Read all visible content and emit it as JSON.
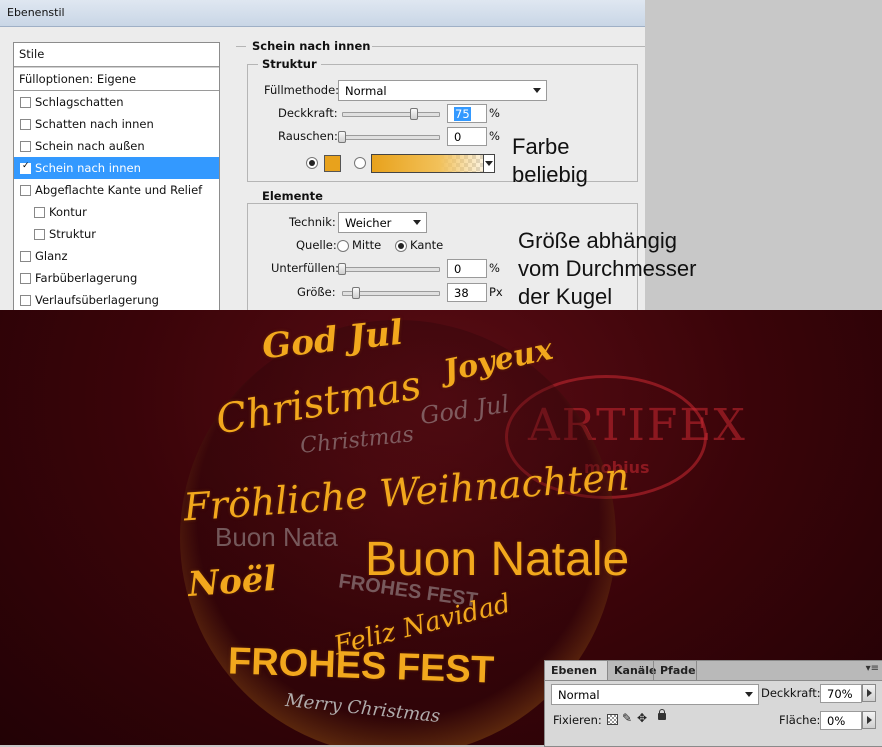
{
  "dialog": {
    "title": "Ebenenstil",
    "styles_header": "Stile",
    "blend_options": "Fülloptionen: Eigene",
    "styles": [
      {
        "label": "Schlagschatten",
        "checked": false,
        "indent": false,
        "selected": false
      },
      {
        "label": "Schatten nach innen",
        "checked": false,
        "indent": false,
        "selected": false
      },
      {
        "label": "Schein nach außen",
        "checked": false,
        "indent": false,
        "selected": false
      },
      {
        "label": "Schein nach innen",
        "checked": true,
        "indent": false,
        "selected": true
      },
      {
        "label": "Abgeflachte Kante und Relief",
        "checked": false,
        "indent": false,
        "selected": false
      },
      {
        "label": "Kontur",
        "checked": false,
        "indent": true,
        "selected": false
      },
      {
        "label": "Struktur",
        "checked": false,
        "indent": true,
        "selected": false
      },
      {
        "label": "Glanz",
        "checked": false,
        "indent": false,
        "selected": false
      },
      {
        "label": "Farbüberlagerung",
        "checked": false,
        "indent": false,
        "selected": false
      },
      {
        "label": "Verlaufsüberlagerung",
        "checked": false,
        "indent": false,
        "selected": false
      }
    ],
    "section_title": "Schein nach innen",
    "structure": {
      "title": "Struktur",
      "blend_mode_label": "Füllmethode:",
      "blend_mode_value": "Normal",
      "opacity_label": "Deckkraft:",
      "opacity_value": "75",
      "opacity_unit": "%",
      "opacity_slider": 0.75,
      "noise_label": "Rauschen:",
      "noise_value": "0",
      "noise_unit": "%",
      "noise_slider": 0.0,
      "color_swatch": "#e8a21c"
    },
    "elements": {
      "title": "Elemente",
      "technique_label": "Technik:",
      "technique_value": "Weicher",
      "source_label": "Quelle:",
      "source_center": "Mitte",
      "source_edge": "Kante",
      "choke_label": "Unterfüllen:",
      "choke_value": "0",
      "choke_unit": "%",
      "choke_slider": 0.0,
      "size_label": "Größe:",
      "size_value": "38",
      "size_unit": "Px",
      "size_slider": 0.15
    }
  },
  "annotations": {
    "color_note_line1": "Farbe",
    "color_note_line2": "beliebig",
    "size_note_line1": "Größe abhängig",
    "size_note_line2": "vom Durchmesser",
    "size_note_line3": "der Kugel"
  },
  "artwork": {
    "words": [
      "God Jul",
      "Joyeux",
      "Christmas",
      "God Jul",
      "Christmas",
      "Fröhliche Weihnachten",
      "Buon Nata",
      "Buon Natale",
      "Noël",
      "FROHES FEST",
      "Feliz Navidad",
      "FROHES FEST",
      "Merry Christmas"
    ],
    "watermark_text": "ARTIFEX",
    "watermark_sub": "mobius",
    "text_color": "#f2a81d",
    "bg_color": "#3a0409"
  },
  "layers_panel": {
    "tabs": [
      "Ebenen",
      "Kanäle",
      "Pfade"
    ],
    "blend_mode": "Normal",
    "opacity_label": "Deckkraft:",
    "opacity_value": "70%",
    "lock_label": "Fixieren:",
    "fill_label": "Fläche:",
    "fill_value": "0%"
  }
}
